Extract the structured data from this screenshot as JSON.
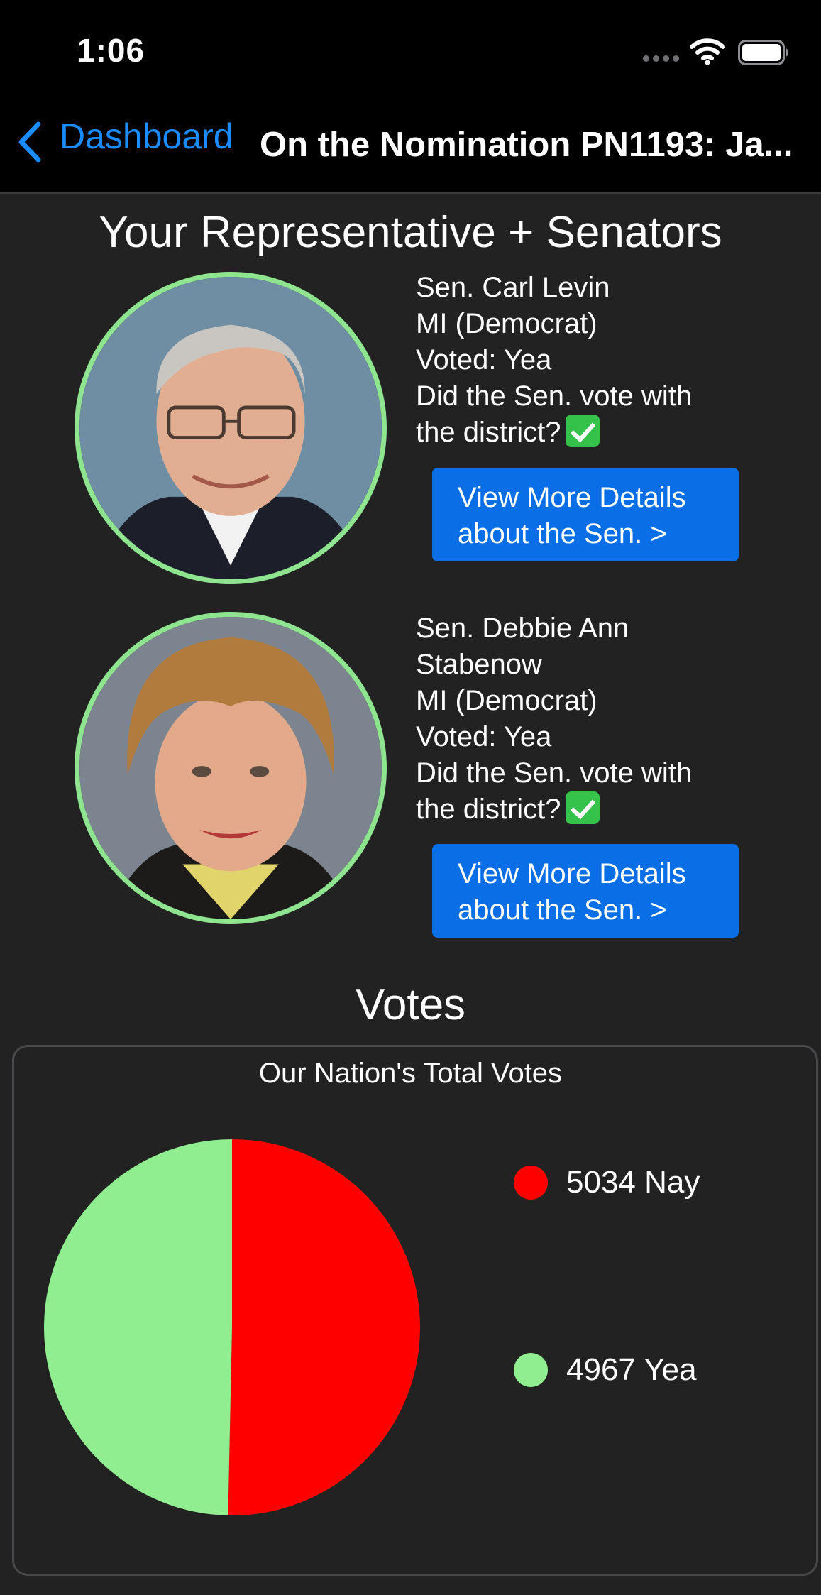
{
  "status_bar": {
    "time": "1:06"
  },
  "nav": {
    "back_label": "Dashboard",
    "title": "On the Nomination PN1193: Ja..."
  },
  "reps_section": {
    "title": "Your Representative + Senators"
  },
  "senators": [
    {
      "lines": [
        "Sen. Carl  Levin",
        "MI (Democrat)",
        "Voted: Yea",
        "Did the Sen. vote with",
        "the district?"
      ],
      "button_lines": [
        "View More Details",
        "about the Sen. >"
      ]
    },
    {
      "lines": [
        "Sen. Debbie Ann",
        "Stabenow",
        "MI (Democrat)",
        "Voted: Yea",
        "Did the Sen. vote with",
        "the district?"
      ],
      "button_lines": [
        "View More Details",
        "about the Sen. >"
      ]
    }
  ],
  "votes_section": {
    "title": "Votes"
  },
  "colors": {
    "accent": "#1a8cff",
    "button": "#0a6fe6",
    "nay": "#ff0000",
    "yea": "#90ee90",
    "avatar_ring": "#8fe48f"
  },
  "chart_data": {
    "type": "pie",
    "title": "Our Nation's Total Votes",
    "slices": [
      {
        "label": "5034 Nay",
        "value": 5034,
        "color": "#ff0000"
      },
      {
        "label": "4967 Yea",
        "value": 4967,
        "color": "#90ee90"
      }
    ],
    "legend_position": "right"
  }
}
